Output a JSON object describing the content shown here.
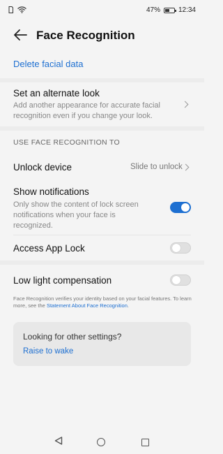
{
  "status_bar": {
    "sim_icon": "sim-icon",
    "wifi_icon": "wifi-icon",
    "battery_percent": "47%",
    "battery_level": 0.47,
    "time": "12:34"
  },
  "header": {
    "back_icon": "back-arrow-icon",
    "title": "Face Recognition"
  },
  "delete_label": "Delete facial data",
  "alternate_look": {
    "title": "Set an alternate look",
    "subtitle": "Add another appearance for accurate facial recognition even if you change your look."
  },
  "section_heading": "USE FACE RECOGNITION TO",
  "unlock_device": {
    "title": "Unlock device",
    "value": "Slide to unlock"
  },
  "show_notifications": {
    "title": "Show notifications",
    "subtitle": "Only show the content of lock screen notifications when your face is recognized.",
    "enabled": true
  },
  "app_lock": {
    "title": "Access App Lock",
    "enabled": false
  },
  "low_light": {
    "title": "Low light compensation",
    "enabled": false
  },
  "footnote": {
    "text": "Face Recognition verifies your identity based on your facial features. To learn more, see the",
    "link": "Statement About Face Recognition",
    "end": "."
  },
  "other_settings": {
    "title": "Looking for other settings?",
    "link": "Raise to wake"
  },
  "colors": {
    "accent": "#1d6fd1",
    "background": "#f4f4f4"
  }
}
